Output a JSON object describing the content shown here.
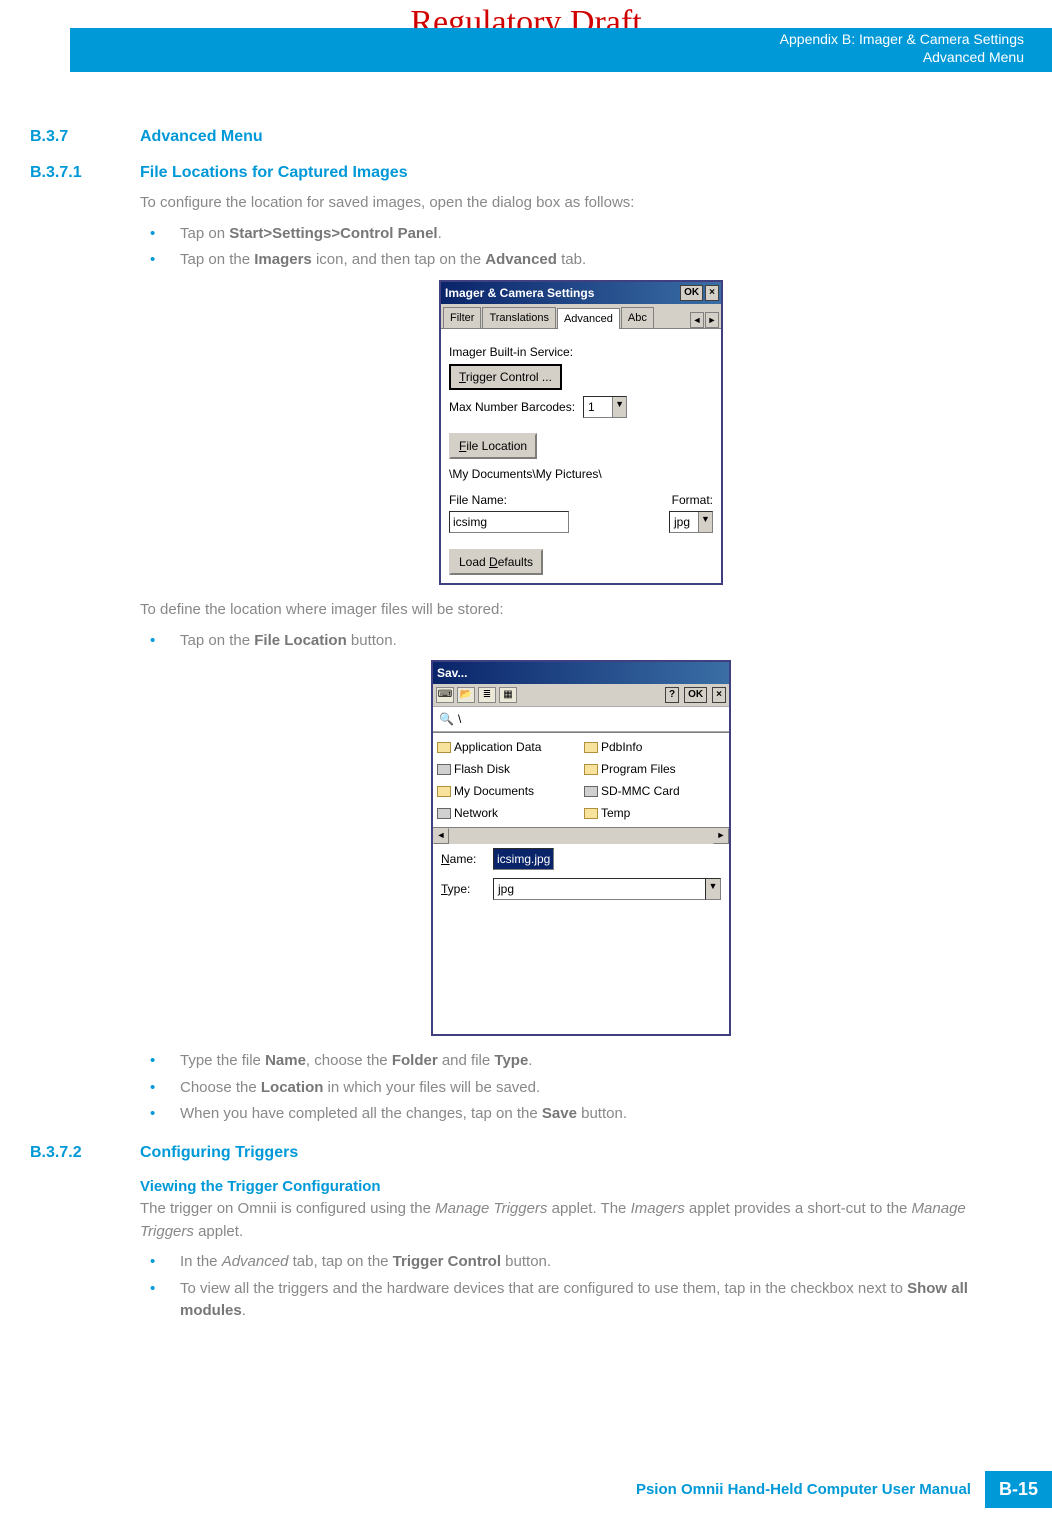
{
  "watermark": "Regulatory Draft",
  "header": {
    "line1": "Appendix B: Imager & Camera Settings",
    "line2": "Advanced Menu"
  },
  "sections": {
    "s1": {
      "num": "B.3.7",
      "title": "Advanced Menu"
    },
    "s2": {
      "num": "B.3.7.1",
      "title": "File Locations for Captured Images"
    },
    "s3": {
      "num": "B.3.7.2",
      "title": "Configuring Triggers"
    }
  },
  "body": {
    "p1": "To configure the location for saved images, open the dialog box as follows:",
    "b1a_pre": "Tap on ",
    "b1a_bold": "Start>Settings>Control Panel",
    "b1a_post": ".",
    "b1b_pre": "Tap on the ",
    "b1b_bold1": "Imagers",
    "b1b_mid": " icon, and then tap on the ",
    "b1b_bold2": "Advanced",
    "b1b_post": " tab.",
    "p2": "To define the location where imager files will be stored:",
    "b2a_pre": "Tap on the ",
    "b2a_bold": "File Location",
    "b2a_post": " button.",
    "b3a_pre": "Type the file ",
    "b3a_bold1": "Name",
    "b3a_mid1": ", choose the ",
    "b3a_bold2": "Folder",
    "b3a_mid2": " and file ",
    "b3a_bold3": "Type",
    "b3a_post": ".",
    "b3b_pre": "Choose the ",
    "b3b_bold": "Location",
    "b3b_post": " in which your files will be saved.",
    "b3c_pre": "When you have completed all the changes, tap on the ",
    "b3c_bold": "Save",
    "b3c_post": " button.",
    "sub1": "Viewing the Trigger Configuration",
    "p3a": "The trigger on Omnii is configured using the ",
    "p3b": "Manage Triggers",
    "p3c": " applet. The ",
    "p3d": "Imagers",
    "p3e": " applet provides a short-cut to the ",
    "p3f": "Manage Triggers",
    "p3g": " applet.",
    "b4a_pre": "In the ",
    "b4a_it": "Advanced",
    "b4a_mid": " tab, tap on the ",
    "b4a_bold": "Trigger Control",
    "b4a_post": " button.",
    "b4b_pre": "To view all the triggers and the hardware devices that are configured to use them, tap in the checkbox next to ",
    "b4b_bold": "Show all modules",
    "b4b_post": "."
  },
  "shot1": {
    "title": "Imager & Camera Settings",
    "ok": "OK",
    "tabs": {
      "t1": "Filter",
      "t2": "Translations",
      "t3": "Advanced",
      "t4": "Abc"
    },
    "label1": "Imager Built-in Service:",
    "btn_trigger_pre": "T",
    "btn_trigger_rest": "rigger Control ...",
    "label2": "Max Number Barcodes:",
    "combo1": "1",
    "btn_fileloc_pre": "F",
    "btn_fileloc_rest": "ile Location",
    "path": "\\My Documents\\My Pictures\\",
    "label3": "File Name:",
    "label4": "Format:",
    "filename": "icsimg",
    "format": "jpg",
    "btn_defaults_pre": "D",
    "btn_defaults_pretext": "Load ",
    "btn_defaults_rest": "efaults"
  },
  "shot2": {
    "title": "Sav...",
    "help": "?",
    "ok": "OK",
    "path_icon": "🔍",
    "path": "\\",
    "files": {
      "f1": "Application Data",
      "f2": "PdbInfo",
      "f3": "Flash Disk",
      "f4": "Program Files",
      "f5": "My Documents",
      "f6": "SD-MMC Card",
      "f7": "Network",
      "f8": "Temp"
    },
    "name_lbl_pre": "N",
    "name_lbl_rest": "ame:",
    "name_val": "icsimg.jpg",
    "type_lbl_pre": "T",
    "type_lbl_rest": "ype:",
    "type_val": "jpg"
  },
  "footer": {
    "text": "Psion Omnii Hand-Held Computer User Manual",
    "page": "B-15"
  }
}
